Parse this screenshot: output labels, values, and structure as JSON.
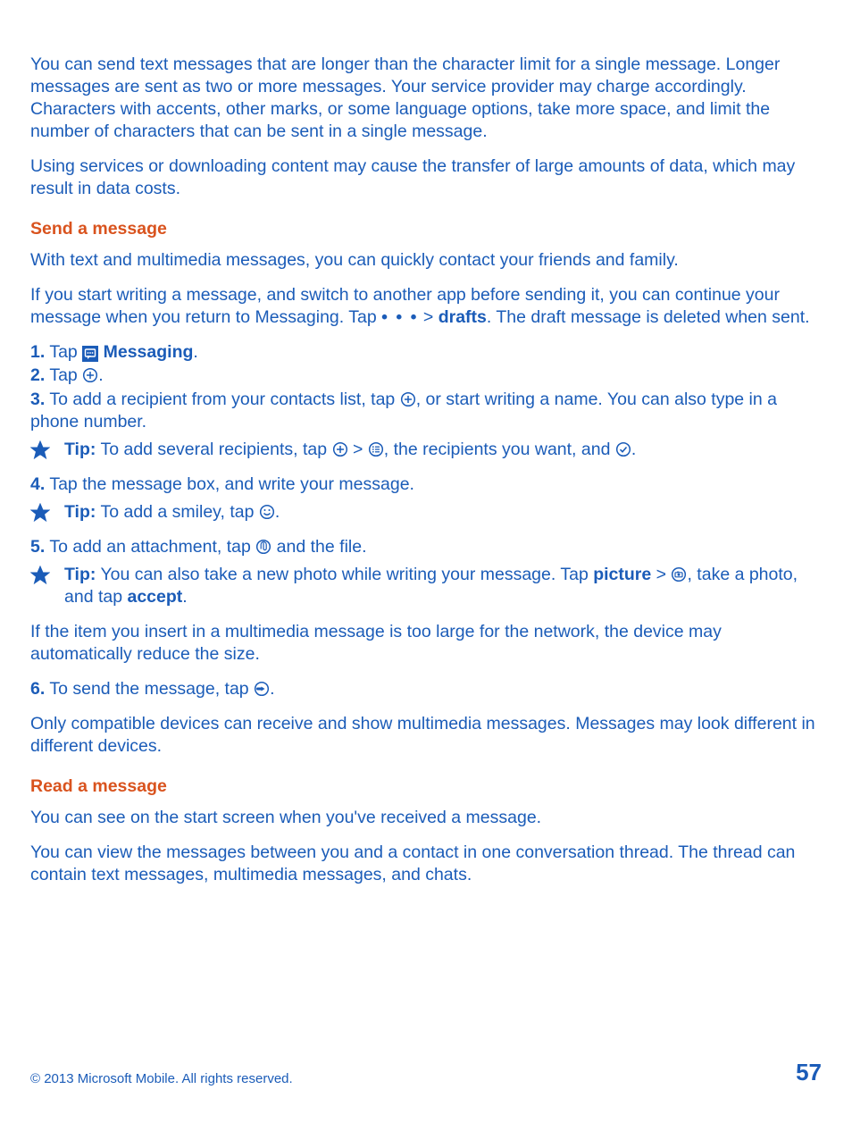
{
  "intro": {
    "p1": "You can send text messages that are longer than the character limit for a single message. Longer messages are sent as two or more messages. Your service provider may charge accordingly. Characters with accents, other marks, or some language options, take more space, and limit the number of characters that can be sent in a single message.",
    "p2": "Using services or downloading content may cause the transfer of large amounts of data, which may result in data costs."
  },
  "section_send": {
    "heading": "Send a message",
    "p1": "With text and multimedia messages, you can quickly contact your friends and family.",
    "p2a": "If you start writing a message, and switch to another app before sending it, you can continue your message when you return to Messaging. Tap ",
    "p2_more": "• • •",
    "p2b": "  > ",
    "p2_drafts": "drafts",
    "p2c": ". The draft message is deleted when sent.",
    "step1_num": "1.",
    "step1_a": " Tap ",
    "step1_app": " Messaging",
    "step1_end": ".",
    "step2_num": "2.",
    "step2_a": " Tap ",
    "step2_end": ".",
    "step3_num": "3.",
    "step3_a": " To add a recipient from your contacts list, tap ",
    "step3_b": ", or start writing a name. You can also type in a phone number.",
    "tip1_label": "Tip:",
    "tip1_a": " To add several recipients, tap ",
    "tip1_b": " > ",
    "tip1_c": ", the recipients you want, and ",
    "tip1_d": ".",
    "step4_num": "4.",
    "step4_a": " Tap the message box, and write your message.",
    "tip2_label": "Tip:",
    "tip2_a": " To add a smiley, tap ",
    "tip2_b": ".",
    "step5_num": "5.",
    "step5_a": " To add an attachment, tap ",
    "step5_b": " and the file.",
    "tip3_label": "Tip:",
    "tip3_a": " You can also take a new photo while writing your message. Tap ",
    "tip3_pic": "picture",
    "tip3_b": " > ",
    "tip3_c": ", take a photo, and tap ",
    "tip3_accept": "accept",
    "tip3_d": ".",
    "p_large": "If the item you insert in a multimedia message is too large for the network, the device may automatically reduce the size.",
    "step6_num": "6.",
    "step6_a": " To send the message, tap ",
    "step6_b": ".",
    "p_compat": "Only compatible devices can receive and show multimedia messages. Messages may look different in different devices."
  },
  "section_read": {
    "heading": "Read a message",
    "p1": "You can see on the start screen when you've received a message.",
    "p2": "You can view the messages between you and a contact in one conversation thread. The thread can contain text messages, multimedia messages, and chats."
  },
  "footer": {
    "copyright": "© 2013 Microsoft Mobile. All rights reserved.",
    "page": "57"
  }
}
